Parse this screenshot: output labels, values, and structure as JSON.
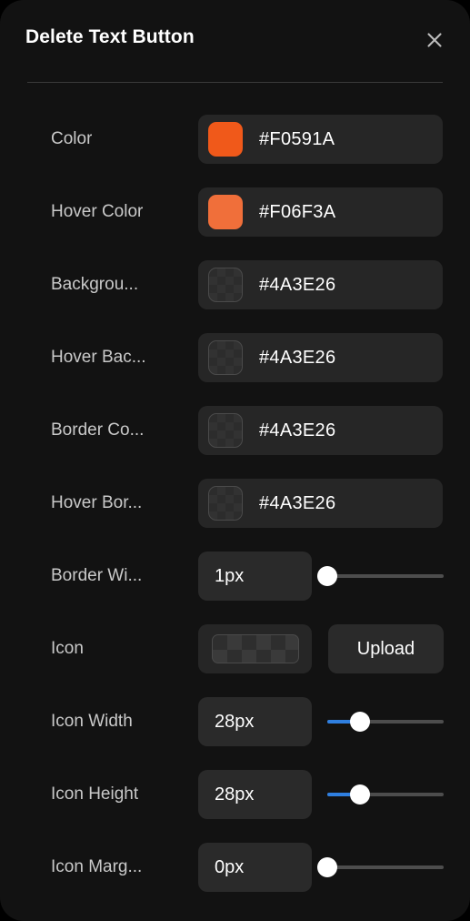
{
  "panel": {
    "title": "Delete Text Button",
    "close_icon": "close-icon",
    "accent_color": "#2F7FE0",
    "panel_background": "#121212",
    "field_background": "#262626"
  },
  "rows": [
    {
      "label": "Color",
      "type": "color",
      "value": "#F0591A",
      "swatch_color": "#F0591A",
      "transparent": false
    },
    {
      "label": "Hover Color",
      "type": "color",
      "value": "#F06F3A",
      "swatch_color": "#F06F3A",
      "transparent": false
    },
    {
      "label": "Backgrou...",
      "type": "color",
      "value": "#4A3E26",
      "swatch_color": "",
      "transparent": true
    },
    {
      "label": "Hover Bac...",
      "type": "color",
      "value": "#4A3E26",
      "swatch_color": "",
      "transparent": true
    },
    {
      "label": "Border Co...",
      "type": "color",
      "value": "#4A3E26",
      "swatch_color": "",
      "transparent": true
    },
    {
      "label": "Hover Bor...",
      "type": "color",
      "value": "#4A3E26",
      "swatch_color": "",
      "transparent": true
    },
    {
      "label": "Border Wi...",
      "type": "slider",
      "value": "1px",
      "slider_percent": 0
    },
    {
      "label": "Icon",
      "type": "upload",
      "value": "",
      "upload_label": "Upload"
    },
    {
      "label": "Icon Width",
      "type": "slider",
      "value": "28px",
      "slider_percent": 28
    },
    {
      "label": "Icon Height",
      "type": "slider",
      "value": "28px",
      "slider_percent": 28
    },
    {
      "label": "Icon Marg...",
      "type": "slider",
      "value": "0px",
      "slider_percent": 0
    }
  ]
}
